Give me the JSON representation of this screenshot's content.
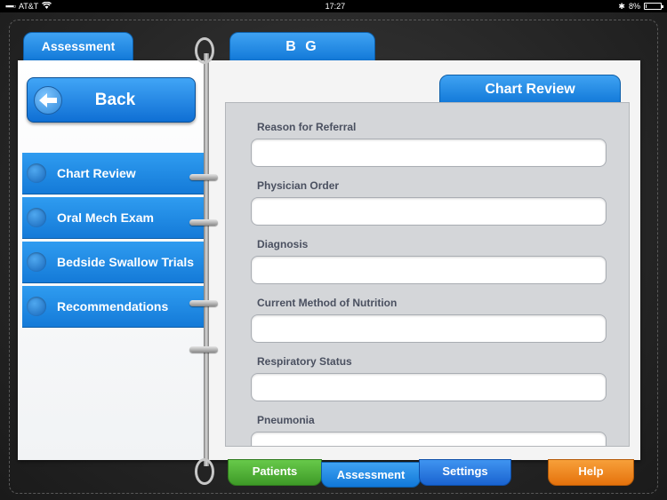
{
  "status_bar": {
    "carrier": "AT&T",
    "time": "17:27",
    "battery": "8%",
    "battery_level": 0.08
  },
  "header_tabs": {
    "assessment": "Assessment",
    "patient_initials": "B G"
  },
  "left_panel": {
    "back_label": "Back",
    "nav_items": [
      {
        "label": "Chart Review"
      },
      {
        "label": "Oral Mech Exam"
      },
      {
        "label": "Bedside Swallow Trials"
      },
      {
        "label": "Recommendations"
      }
    ]
  },
  "right_panel": {
    "section_tab": "Chart Review",
    "fields": [
      {
        "label": "Reason for Referral",
        "value": ""
      },
      {
        "label": "Physician Order",
        "value": ""
      },
      {
        "label": "Diagnosis",
        "value": ""
      },
      {
        "label": "Current Method of Nutrition",
        "value": ""
      },
      {
        "label": "Respiratory Status",
        "value": ""
      },
      {
        "label": "Pneumonia",
        "value": ""
      }
    ]
  },
  "bottom_tabs": {
    "patients": "Patients",
    "assessment": "Assessment",
    "settings": "Settings",
    "help": "Help"
  },
  "colors": {
    "accent_blue": "#1a86e3",
    "patients_green": "#4fb033",
    "help_orange": "#ee8520",
    "leather": "#2a2a2a"
  }
}
